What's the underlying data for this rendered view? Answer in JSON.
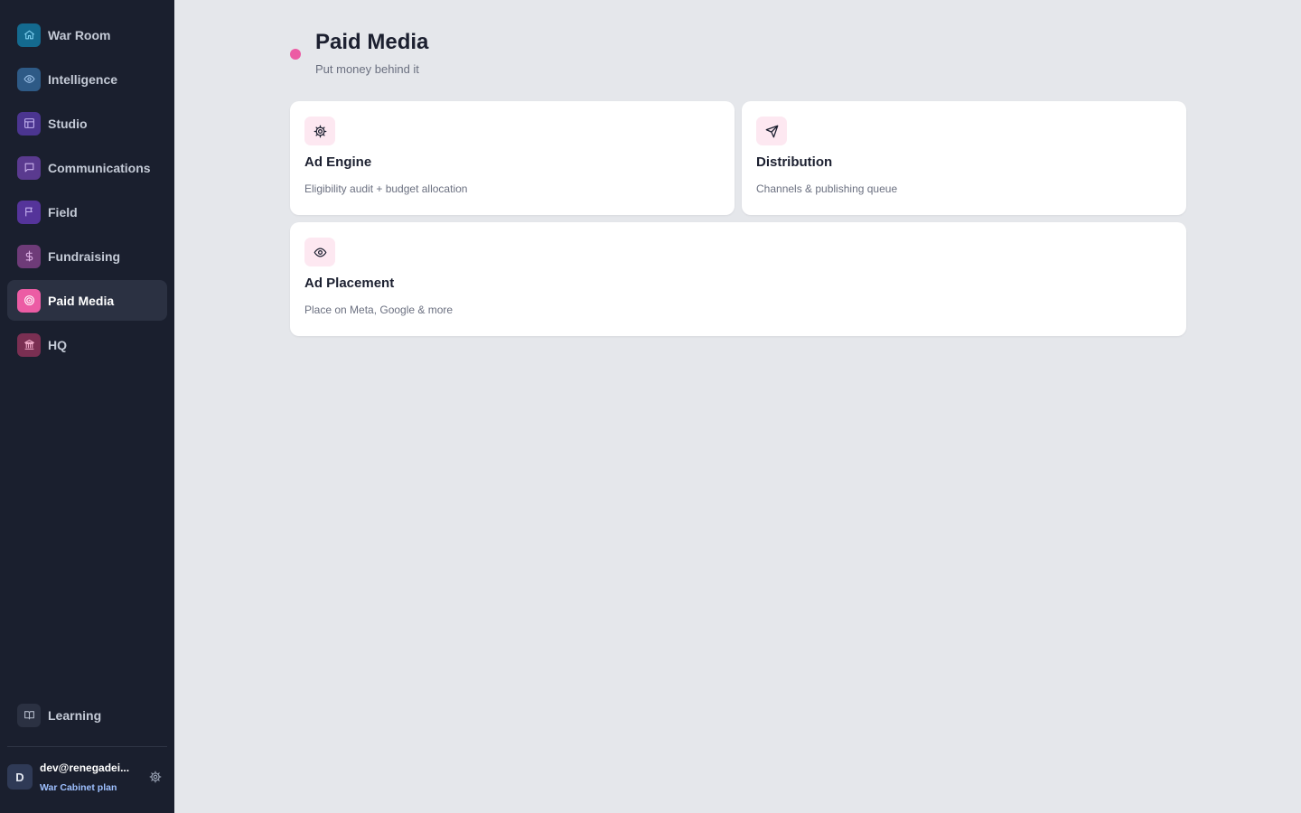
{
  "sidebar": {
    "items": [
      {
        "id": "war-room",
        "label": "War Room",
        "icon": "home-icon",
        "color": "#146a8f",
        "stroke": "#7fd0f0"
      },
      {
        "id": "intelligence",
        "label": "Intelligence",
        "icon": "eye-icon",
        "color": "#2e5a86",
        "stroke": "#9ec3ea"
      },
      {
        "id": "studio",
        "label": "Studio",
        "icon": "layout-icon",
        "color": "#4b3590",
        "stroke": "#c3b3f0"
      },
      {
        "id": "communications",
        "label": "Communications",
        "icon": "message-icon",
        "color": "#5a3a8f",
        "stroke": "#cbb3ee"
      },
      {
        "id": "field",
        "label": "Field",
        "icon": "flag-icon",
        "color": "#55349a",
        "stroke": "#c6b2f0"
      },
      {
        "id": "fundraising",
        "label": "Fundraising",
        "icon": "dollar-icon",
        "color": "#6e3b78",
        "stroke": "#e0b4e8"
      },
      {
        "id": "paid-media",
        "label": "Paid Media",
        "icon": "target-icon",
        "color": "#ec5ca4",
        "stroke": "#ffffff",
        "active": true
      },
      {
        "id": "hq",
        "label": "HQ",
        "icon": "building-icon",
        "color": "#7a2f52",
        "stroke": "#f0aac8"
      }
    ],
    "learning": {
      "label": "Learning",
      "icon": "book-icon",
      "color": "#2b3142",
      "stroke": "#b5bccb"
    },
    "user": {
      "initial": "D",
      "email": "dev@renegadei...",
      "plan": "War Cabinet plan",
      "icon": "gear-icon"
    }
  },
  "header": {
    "title": "Paid Media",
    "subtitle": "Put money behind it",
    "dot_color": "#ec5ca4"
  },
  "cards": [
    {
      "id": "ad-engine",
      "title": "Ad Engine",
      "description": "Eligibility audit + budget allocation",
      "icon": "gear-icon"
    },
    {
      "id": "distribution",
      "title": "Distribution",
      "description": "Channels & publishing queue",
      "icon": "send-icon"
    },
    {
      "id": "ad-placement",
      "title": "Ad Placement",
      "description": "Place on Meta, Google & more",
      "icon": "eye-icon"
    }
  ],
  "card_icon_bg": "#fde8f1"
}
